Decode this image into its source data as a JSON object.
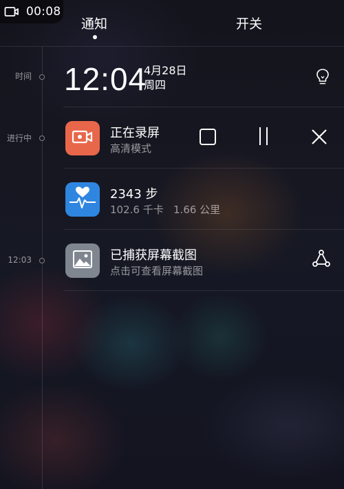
{
  "status_bar": {
    "time": "00:08",
    "icon": "screen-record-icon"
  },
  "tabs": [
    {
      "label": "通知",
      "active": true
    },
    {
      "label": "开关",
      "active": false
    }
  ],
  "timeline": {
    "label_time": "时间",
    "label_ongoing": "进行中",
    "label_1203": "12:03"
  },
  "clock": {
    "time": "12:04",
    "date": "4月28日",
    "weekday": "周四",
    "icon": "lightbulb-icon"
  },
  "notifications": {
    "recording": {
      "title": "正在录屏",
      "subtitle": "高清模式",
      "icon": "video-camera-icon",
      "icon_color": "#e8674a",
      "controls": [
        "stop-icon",
        "pause-icon",
        "close-icon"
      ]
    },
    "health": {
      "title": "2343 步",
      "subtitle": "102.6 千卡   1.66 公里",
      "icon": "heart-pulse-icon",
      "icon_color": "#2f86e0"
    },
    "screenshot": {
      "title": "已捕获屏幕截图",
      "subtitle": "点击可查看屏幕截图",
      "icon": "image-icon",
      "icon_color": "#7f8690",
      "action_icon": "share-icon"
    }
  }
}
